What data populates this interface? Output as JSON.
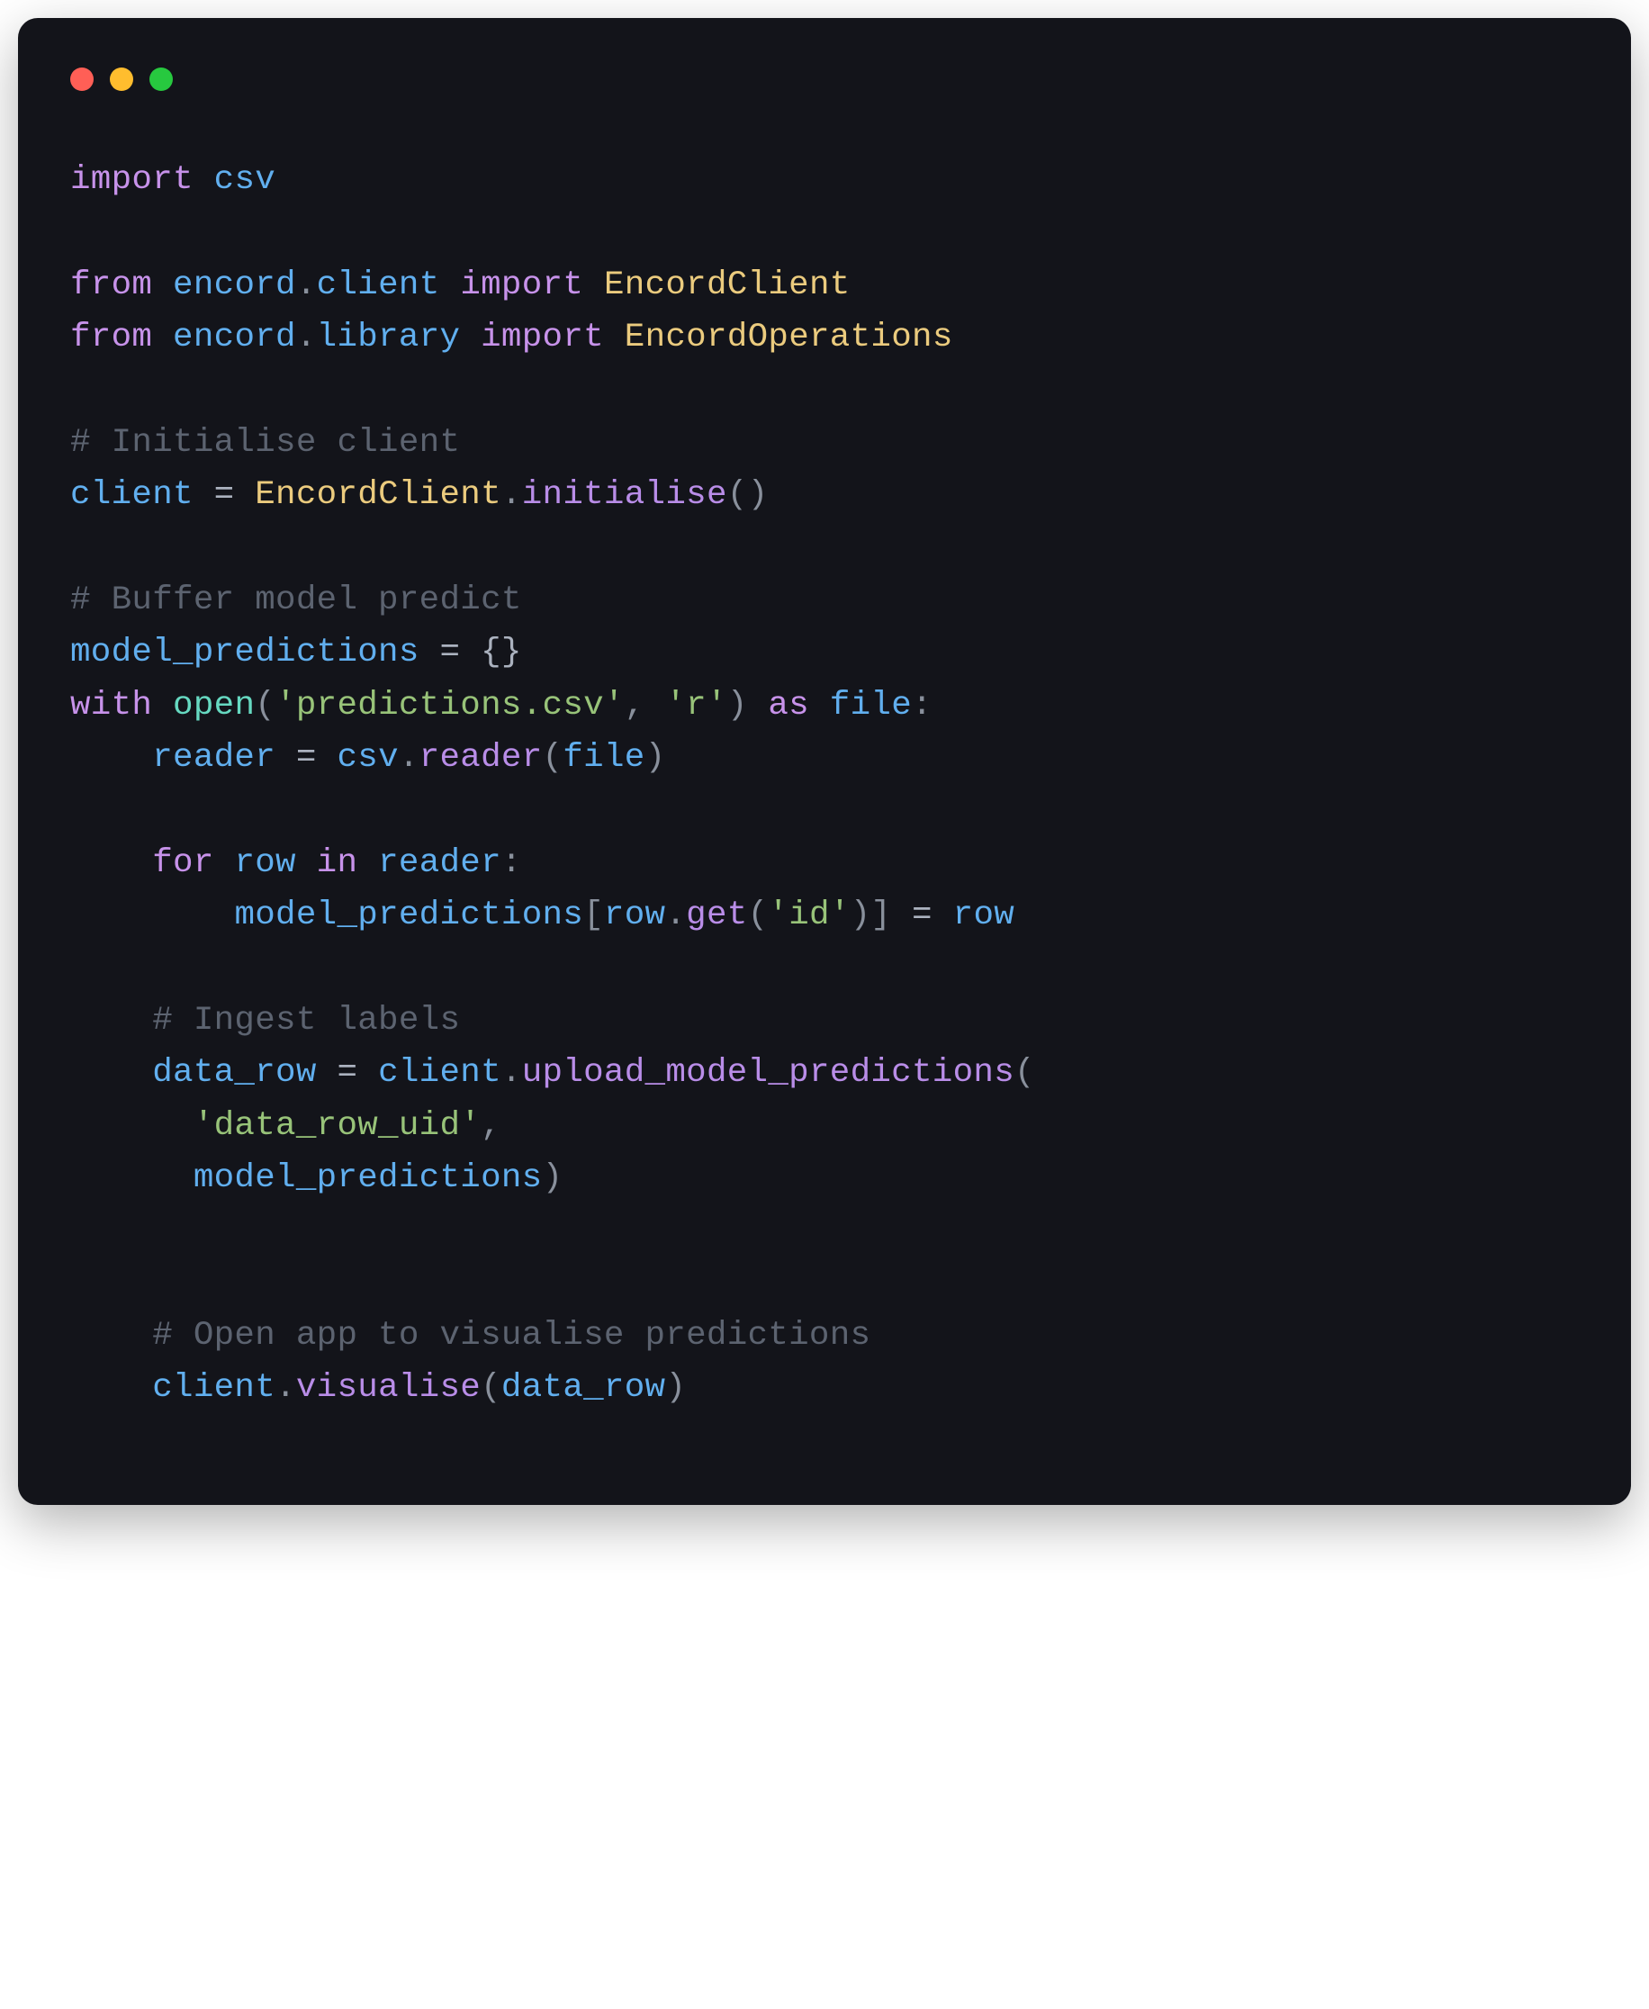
{
  "window": {
    "controls": [
      "close",
      "minimize",
      "maximize"
    ]
  },
  "code": {
    "l1": {
      "import": "import",
      "csv": "csv"
    },
    "l3": {
      "from": "from",
      "mod1": "encord",
      "dot": ".",
      "mod2": "client",
      "import": "import",
      "cls": "EncordClient"
    },
    "l4": {
      "from": "from",
      "mod1": "encord",
      "dot": ".",
      "mod2": "library",
      "import": "import",
      "cls": "EncordOperations"
    },
    "l6": {
      "comment": "# Initialise client"
    },
    "l7": {
      "var": "client",
      "eq": " = ",
      "cls": "EncordClient",
      "dot": ".",
      "fn": "initialise",
      "parens": "()"
    },
    "l9": {
      "comment": "# Buffer model predict"
    },
    "l10": {
      "var": "model_predictions",
      "eq": " = {}",
      "braces": ""
    },
    "l11": {
      "with": "with",
      "fn": "open",
      "paren_o": "(",
      "str1": "'predictions.csv'",
      "comma": ", ",
      "str2": "'r'",
      "paren_c": ")",
      "as": " as ",
      "file": "file",
      "colon": ":"
    },
    "l12": {
      "indent": "    ",
      "var": "reader",
      "eq": " = ",
      "mod": "csv",
      "dot": ".",
      "fn": "reader",
      "paren_o": "(",
      "arg": "file",
      "paren_c": ")"
    },
    "l14": {
      "indent": "    ",
      "for": "for",
      "row": " row ",
      "in": "in",
      "reader": " reader",
      "colon": ":"
    },
    "l15": {
      "indent": "        ",
      "var": "model_predictions",
      "bracket_o": "[",
      "row": "row",
      "dot": ".",
      "fn": "get",
      "paren_o": "(",
      "str": "'id'",
      "paren_c": ")",
      "bracket_c": "]",
      "eq": " = ",
      "row2": "row"
    },
    "l17": {
      "indent": "    ",
      "comment": "# Ingest labels"
    },
    "l18": {
      "indent": "    ",
      "var": "data_row",
      "eq": " = ",
      "client": "client",
      "dot": ".",
      "fn": "upload_model_predictions",
      "paren_o": "("
    },
    "l19": {
      "indent": "      ",
      "str": "'data_row_uid'",
      "comma": ","
    },
    "l20": {
      "indent": "      ",
      "var": "model_predictions",
      "paren_c": ")"
    },
    "l23": {
      "indent": "    ",
      "comment": "# Open app to visualise predictions"
    },
    "l24": {
      "indent": "    ",
      "client": "client",
      "dot": ".",
      "fn": "visualise",
      "paren_o": "(",
      "arg": "data_row",
      "paren_c": ")"
    }
  }
}
